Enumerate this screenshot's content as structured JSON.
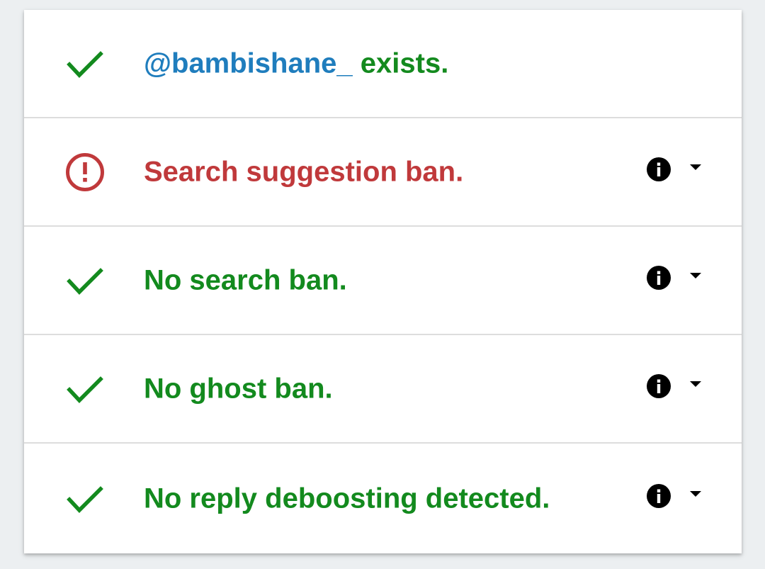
{
  "colors": {
    "success": "#138a1e",
    "error": "#c0393b",
    "handle": "#1f7dbd",
    "background": "#eceff1"
  },
  "results": [
    {
      "status": "check-icon",
      "handle": "@bambishane_",
      "text": " exists."
    },
    {
      "status": "alert-circle-icon",
      "text": "Search suggestion ban.",
      "info_icon": "info-icon",
      "toggle_icon": "caret-down-icon"
    },
    {
      "status": "check-icon",
      "text": "No search ban.",
      "info_icon": "info-icon",
      "toggle_icon": "caret-down-icon"
    },
    {
      "status": "check-icon",
      "text": "No ghost ban.",
      "info_icon": "info-icon",
      "toggle_icon": "caret-down-icon"
    },
    {
      "status": "check-icon",
      "text": "No reply deboosting detected.",
      "info_icon": "info-icon",
      "toggle_icon": "caret-down-icon"
    }
  ]
}
